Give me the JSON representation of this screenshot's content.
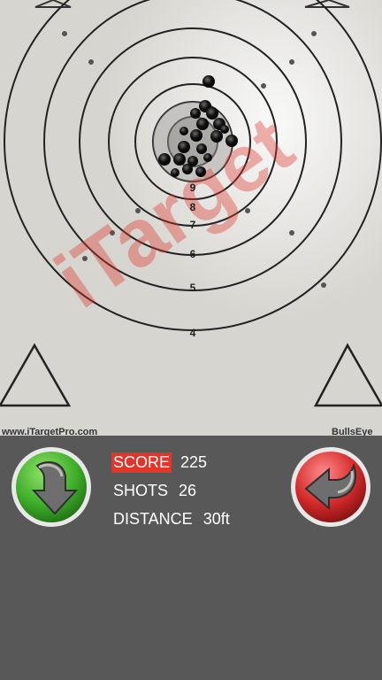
{
  "target": {
    "watermark": "iTarget",
    "website": "www.iTargetPro.com",
    "brand": "BullsEye",
    "ring_numbers": [
      "9",
      "8",
      "7",
      "6",
      "5",
      "4"
    ]
  },
  "stats": {
    "score_label": "SCORE",
    "score_value": "225",
    "shots_label": "SHOTS",
    "shots_value": "26",
    "distance_label": "DISTANCE",
    "distance_value": "30ft"
  },
  "colors": {
    "score_highlight": "#e0352b",
    "reload_button": "#3fae2a",
    "back_button": "#d42a2a",
    "panel_bg": "#585858"
  },
  "icons": {
    "reload": "down-arrow-icon",
    "back": "back-arrow-icon"
  }
}
